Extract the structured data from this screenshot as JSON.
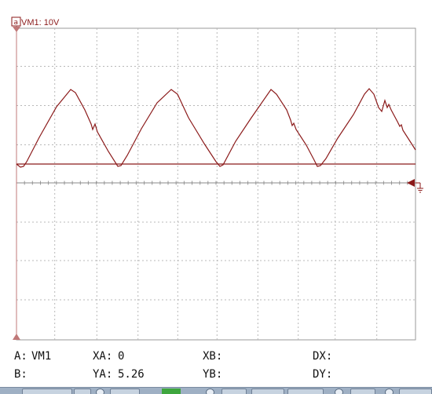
{
  "channel": {
    "marker": "a",
    "label": "VM1: 10V",
    "trace_color": "#8b1a1a",
    "volts_per_div": 10
  },
  "readout": {
    "a_key": "A:",
    "a_val": "VM1",
    "b_key": "B:",
    "b_val": "",
    "xa_key": "XA:",
    "xa_val": "0",
    "ya_key": "YA:",
    "ya_val": "5.26",
    "xb_key": "XB:",
    "xb_val": "",
    "yb_key": "YB:",
    "yb_val": "",
    "dx_key": "DX:",
    "dx_val": "",
    "dy_key": "DY:",
    "dy_val": ""
  },
  "colors": {
    "grid": "#b8b8b8",
    "axis": "#7f7f7f",
    "trace": "#8b1a1a",
    "cursor": "#c07878"
  },
  "icons": {
    "ground": "ground-icon",
    "cursor_a_top": "triangle-down-icon",
    "cursor_a_bottom": "triangle-up-icon",
    "trigger": "triangle-left-icon"
  }
}
